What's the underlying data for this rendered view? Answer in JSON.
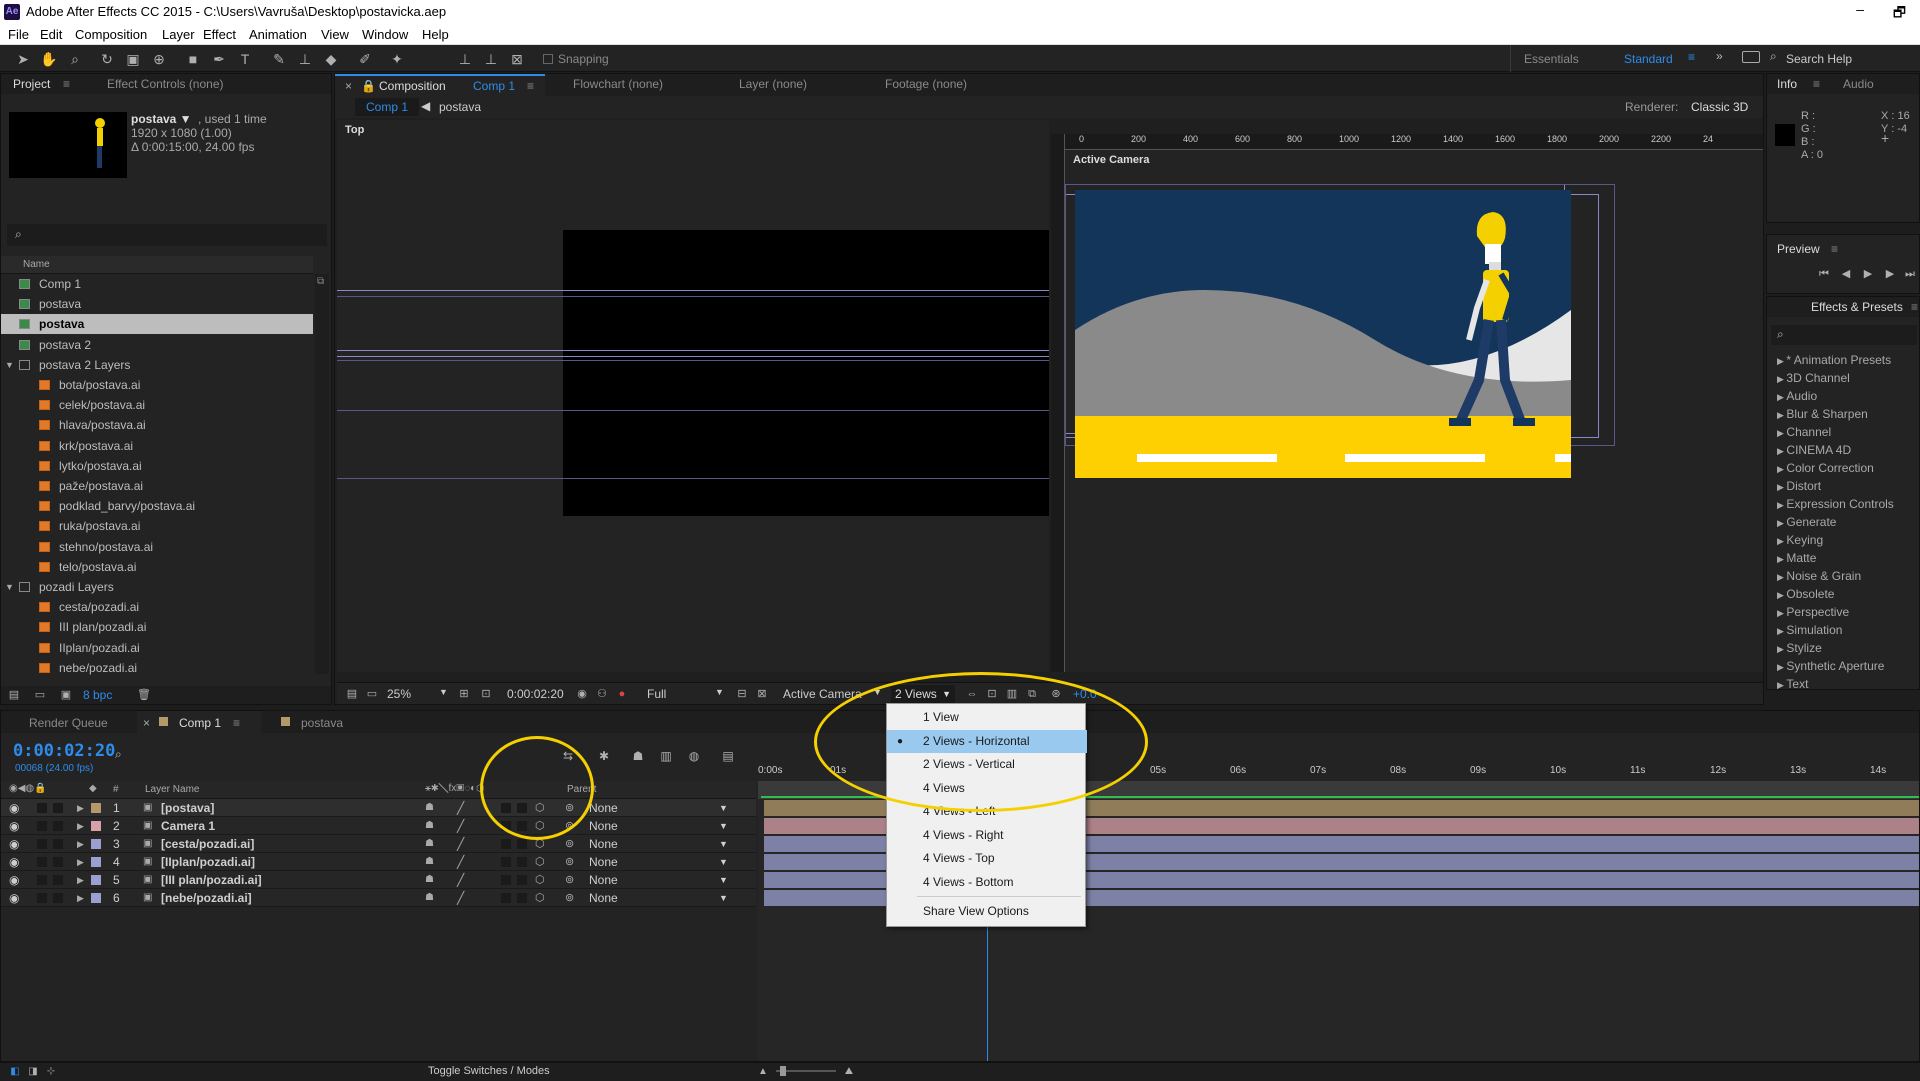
{
  "window": {
    "title": "Adobe After Effects CC 2015 - C:\\Users\\Vavruša\\Desktop\\postavicka.aep",
    "app_icon": "Ae",
    "restore_glyph": "🗗",
    "minimize_glyph": "–"
  },
  "menu": [
    "File",
    "Edit",
    "Composition",
    "Layer",
    "Effect",
    "Animation",
    "View",
    "Window",
    "Help"
  ],
  "toolbar": {
    "snapping_label": "Snapping",
    "workspaces": [
      "Essentials",
      "Standard"
    ],
    "search_help": "Search Help"
  },
  "project": {
    "tabs": [
      "Project",
      "Effect Controls (none)"
    ],
    "preview_name": "postava ▼",
    "preview_used": ", used 1 time",
    "preview_dims": "1920 x 1080 (1.00)",
    "preview_duration": "Δ 0:00:15:00, 24.00 fps",
    "column_name": "Name",
    "items": [
      {
        "label": "Comp 1",
        "type": "comp",
        "indent": 0
      },
      {
        "label": "postava",
        "type": "comp",
        "indent": 0
      },
      {
        "label": "postava",
        "type": "comp",
        "indent": 0,
        "selected": true
      },
      {
        "label": "postava 2",
        "type": "comp",
        "indent": 0
      },
      {
        "label": "postava 2 Layers",
        "type": "folder",
        "indent": 0
      },
      {
        "label": "bota/postava.ai",
        "type": "ai",
        "indent": 1
      },
      {
        "label": "celek/postava.ai",
        "type": "ai",
        "indent": 1
      },
      {
        "label": "hlava/postava.ai",
        "type": "ai",
        "indent": 1
      },
      {
        "label": "krk/postava.ai",
        "type": "ai",
        "indent": 1
      },
      {
        "label": "lytko/postava.ai",
        "type": "ai",
        "indent": 1
      },
      {
        "label": "paže/postava.ai",
        "type": "ai",
        "indent": 1
      },
      {
        "label": "podklad_barvy/postava.ai",
        "type": "ai",
        "indent": 1
      },
      {
        "label": "ruka/postava.ai",
        "type": "ai",
        "indent": 1
      },
      {
        "label": "stehno/postava.ai",
        "type": "ai",
        "indent": 1
      },
      {
        "label": "telo/postava.ai",
        "type": "ai",
        "indent": 1
      },
      {
        "label": "pozadi Layers",
        "type": "folder",
        "indent": 0
      },
      {
        "label": "cesta/pozadi.ai",
        "type": "ai",
        "indent": 1
      },
      {
        "label": "III plan/pozadi.ai",
        "type": "ai",
        "indent": 1
      },
      {
        "label": "IIplan/pozadi.ai",
        "type": "ai",
        "indent": 1
      },
      {
        "label": "nebe/pozadi.ai",
        "type": "ai",
        "indent": 1
      }
    ],
    "bpc": "8 bpc"
  },
  "viewer": {
    "tabs": [
      "Composition",
      "Comp 1",
      "Flowchart (none)",
      "Layer (none)",
      "Footage (none)"
    ],
    "crumbs": [
      "Comp 1",
      "postava"
    ],
    "renderer_label": "Renderer:",
    "renderer_value": "Classic 3D",
    "left_view_label": "Top",
    "right_view_label": "Active Camera",
    "ruler_ticks": [
      "0",
      "200",
      "400",
      "600",
      "800",
      "1000",
      "1200",
      "1400",
      "1600",
      "1800",
      "2000",
      "2200",
      "24"
    ],
    "zoom": "25%",
    "timecode": "0:00:02:20",
    "resolution": "Full",
    "camera": "Active Camera",
    "views": "2 Views",
    "exposure": "+0.0"
  },
  "view_menu": {
    "items": [
      "1 View",
      "2 Views - Horizontal",
      "2 Views - Vertical",
      "4 Views",
      "4 Views - Left",
      "4 Views - Right",
      "4 Views - Top",
      "4 Views - Bottom"
    ],
    "selected_index": 1,
    "share": "Share View Options",
    "selected_mark": "●"
  },
  "info": {
    "tabs": [
      "Info",
      "Audio"
    ],
    "channels": [
      "R :",
      "G :",
      "B :",
      "A : 0"
    ],
    "coords": [
      "X : 16",
      "Y : -4"
    ]
  },
  "preview_panel": {
    "title": "Preview"
  },
  "effects": {
    "title": "Effects & Presets",
    "items": [
      "* Animation Presets",
      "3D Channel",
      "Audio",
      "Blur & Sharpen",
      "Channel",
      "CINEMA 4D",
      "Color Correction",
      "Distort",
      "Expression Controls",
      "Generate",
      "Keying",
      "Matte",
      "Noise & Grain",
      "Obsolete",
      "Perspective",
      "Simulation",
      "Stylize",
      "Synthetic Aperture",
      "Text"
    ]
  },
  "timeline": {
    "tabs": [
      "Render Queue",
      "Comp 1",
      "postava"
    ],
    "timecode": "0:00:02:20",
    "frame_info": "00068 (24.00 fps)",
    "col_layer_name": "Layer Name",
    "col_parent": "Parent",
    "col_num": "#",
    "ruler": [
      "0:00s",
      "01s",
      "05s",
      "06s",
      "07s",
      "08s",
      "09s",
      "10s",
      "11s",
      "12s",
      "13s",
      "14s"
    ],
    "layers": [
      {
        "num": "1",
        "name": "[postava]",
        "color": "#b49a6a",
        "parent": "None"
      },
      {
        "num": "2",
        "name": "Camera 1",
        "color": "#d9a0a8",
        "parent": "None"
      },
      {
        "num": "3",
        "name": "[cesta/pozadi.ai]",
        "color": "#9aa0d0",
        "parent": "None"
      },
      {
        "num": "4",
        "name": "[IIplan/pozadi.ai]",
        "color": "#9aa0d0",
        "parent": "None"
      },
      {
        "num": "5",
        "name": "[III plan/pozadi.ai]",
        "color": "#9aa0d0",
        "parent": "None"
      },
      {
        "num": "6",
        "name": "[nebe/pozadi.ai]",
        "color": "#9aa0d0",
        "parent": "None"
      }
    ],
    "toggle_label": "Toggle Switches / Modes"
  },
  "colors": {
    "accent": "#2d8ceb",
    "highlight": "#f5d000",
    "sky": "#123559",
    "road": "#fed002",
    "hill": "#8a8a8a"
  }
}
